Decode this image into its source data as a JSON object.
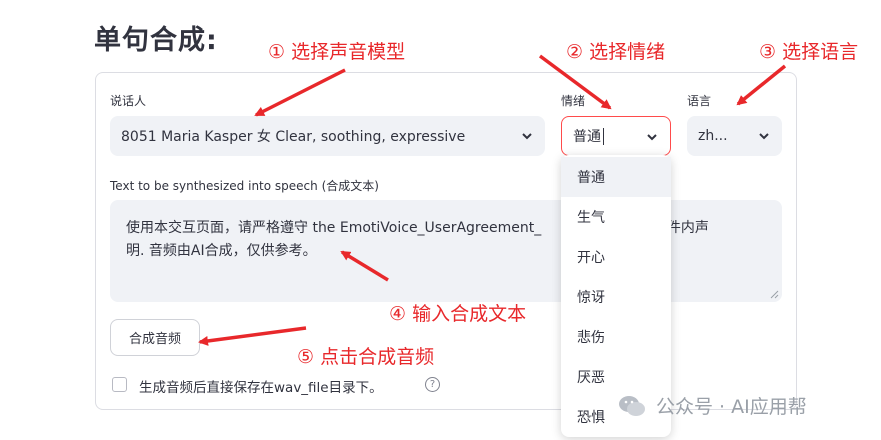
{
  "page": {
    "title": "单句合成:",
    "next_section_partial": ""
  },
  "speaker": {
    "label": "说话人",
    "value": "8051 Maria Kasper 女 Clear, soothing, expressive"
  },
  "emotion": {
    "label": "情绪",
    "value": "普通",
    "options": [
      "普通",
      "生气",
      "开心",
      "惊讶",
      "悲伤",
      "厌恶",
      "恐惧"
    ],
    "selected_index": 0
  },
  "language": {
    "label": "语言",
    "value": "zh..."
  },
  "text_input": {
    "label": "Text to be synthesized into speech (合成文本)",
    "line1": "使用本交互页面，请严格遵守 the EmotiVoice_UserAgreement_",
    "line1_tail": ".pdf 文件内声",
    "line2": "明. 音频由AI合成，仅供参考。"
  },
  "synth_button": {
    "label": "合成音频"
  },
  "save_checkbox": {
    "label": "生成音频后直接保存在wav_file目录下。",
    "checked": false,
    "help_glyph": "?"
  },
  "annotations": {
    "a1": "① 选择声音模型",
    "a2": "② 选择情绪",
    "a3": "③ 选择语言",
    "a4": "④ 输入合成文本",
    "a5": "⑤ 点击合成音频"
  },
  "watermark": {
    "text": "公众号 · AI应用帮"
  },
  "colors": {
    "accent": "#ff4b4b",
    "annotation_red": "#e8282b",
    "input_bg": "#f0f2f6",
    "text": "#31333f"
  }
}
